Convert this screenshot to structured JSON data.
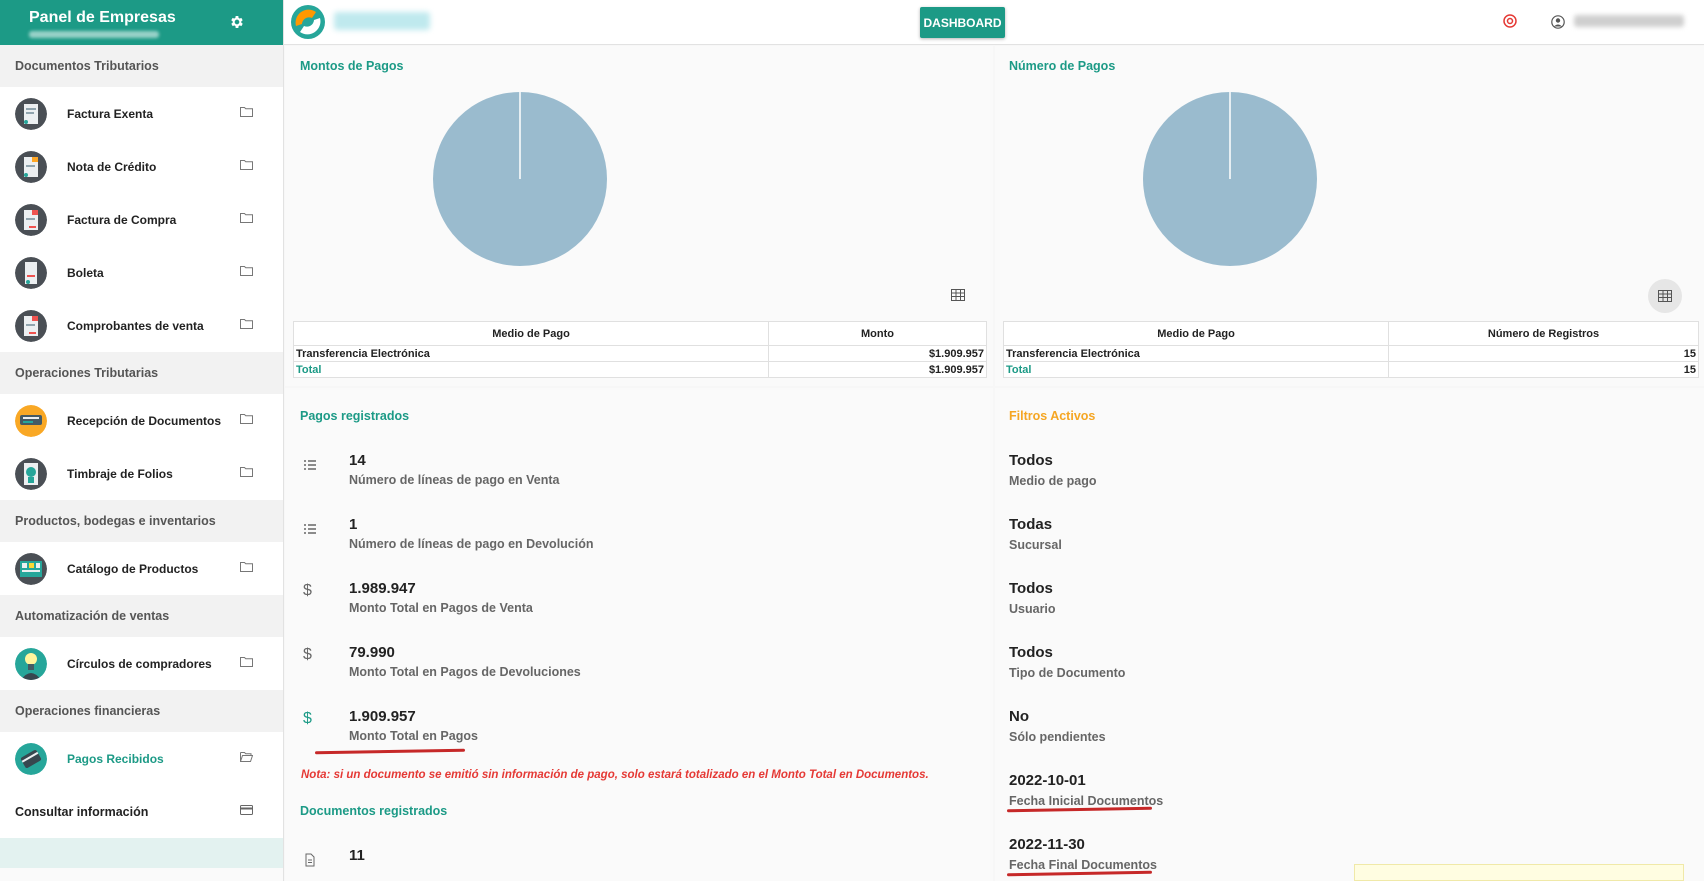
{
  "sidebar": {
    "title": "Panel de Empresas",
    "sections": [
      {
        "label": "Documentos Tributarios",
        "items": [
          {
            "label": "Factura Exenta"
          },
          {
            "label": "Nota de Crédito"
          },
          {
            "label": "Factura de Compra"
          },
          {
            "label": "Boleta"
          },
          {
            "label": "Comprobantes de venta"
          }
        ]
      },
      {
        "label": "Operaciones Tributarias",
        "items": [
          {
            "label": "Recepción de Documentos"
          },
          {
            "label": "Timbraje de Folios"
          }
        ]
      },
      {
        "label": "Productos, bodegas e inventarios",
        "items": [
          {
            "label": "Catálogo de Productos"
          }
        ]
      },
      {
        "label": "Automatización de ventas",
        "items": [
          {
            "label": "Círculos de compradores"
          }
        ]
      },
      {
        "label": "Operaciones financieras",
        "items": [
          {
            "label": "Pagos Recibidos"
          }
        ]
      }
    ],
    "consult_label": "Consultar información"
  },
  "topbar": {
    "dashboard_label": "DASHBOARD"
  },
  "colors": {
    "accent": "#1c9a86",
    "pie": "#9abbce",
    "warning": "#f5a623",
    "note": "#e53935"
  },
  "montos": {
    "title": "Montos de Pagos",
    "headers": [
      "Medio de Pago",
      "Monto"
    ],
    "rows": [
      [
        "Transferencia Electrónica",
        "$1.909.957"
      ]
    ],
    "total": [
      "Total",
      "$1.909.957"
    ]
  },
  "numero": {
    "title": "Número de Pagos",
    "headers": [
      "Medio de Pago",
      "Número de Registros"
    ],
    "rows": [
      [
        "Transferencia Electrónica",
        "15"
      ]
    ],
    "total": [
      "Total",
      "15"
    ]
  },
  "chart_data": [
    {
      "type": "pie",
      "categories": [
        "Transferencia Electrónica"
      ],
      "values": [
        1909957
      ]
    },
    {
      "type": "pie",
      "categories": [
        "Transferencia Electrónica"
      ],
      "values": [
        15
      ]
    }
  ],
  "pagos": {
    "title": "Pagos registrados",
    "stats": [
      {
        "icon": "list-icon",
        "value": "14",
        "label": "Número de líneas de pago en Venta"
      },
      {
        "icon": "list-icon",
        "value": "1",
        "label": "Número de líneas de pago en Devolución"
      },
      {
        "icon": "dollar-icon",
        "value": "1.989.947",
        "label": "Monto Total en Pagos de Venta"
      },
      {
        "icon": "dollar-icon",
        "value": "79.990",
        "label": "Monto Total en Pagos de Devoluciones"
      },
      {
        "icon": "dollar-icon",
        "value": "1.909.957",
        "label": "Monto Total en Pagos"
      }
    ],
    "note": "Nota: si un documento se emitió sin información de pago, solo estará totalizado en el Monto Total en Documentos.",
    "docs_title": "Documentos registrados",
    "docs_value": "11"
  },
  "filtros": {
    "title": "Filtros Activos",
    "items": [
      {
        "value": "Todos",
        "label": "Medio de pago"
      },
      {
        "value": "Todas",
        "label": "Sucursal"
      },
      {
        "value": "Todos",
        "label": "Usuario"
      },
      {
        "value": "Todos",
        "label": "Tipo de Documento"
      },
      {
        "value": "No",
        "label": "Sólo pendientes"
      },
      {
        "value": "2022-10-01",
        "label": "Fecha Inicial Documentos"
      },
      {
        "value": "2022-11-30",
        "label": "Fecha Final Documentos"
      }
    ]
  }
}
